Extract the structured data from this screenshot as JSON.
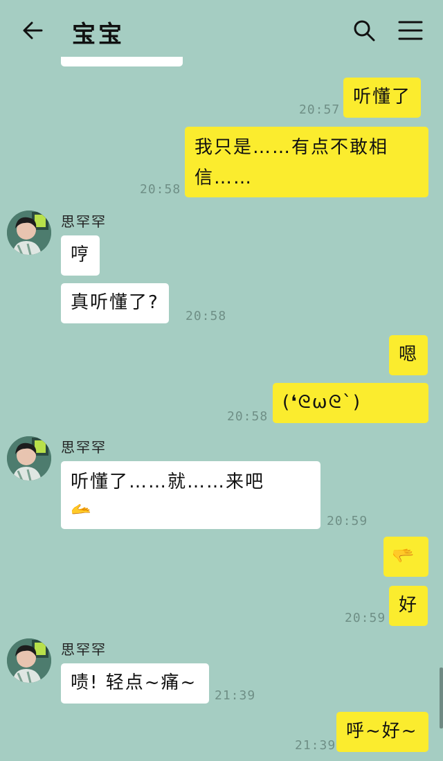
{
  "header": {
    "title": "宝宝",
    "back_icon": "arrow-left-icon",
    "search_icon": "search-icon",
    "menu_icon": "menu-icon"
  },
  "contact": {
    "name": "思罕罕"
  },
  "messages": [
    {
      "from": "me",
      "text": "听懂了",
      "time": "20:57"
    },
    {
      "from": "me",
      "text": "我只是……有点不敢相信……",
      "time": "20:58"
    },
    {
      "from": "them",
      "text": "哼",
      "time": ""
    },
    {
      "from": "them",
      "text": "真听懂了?",
      "time": "20:58"
    },
    {
      "from": "me",
      "text": "嗯",
      "time": ""
    },
    {
      "from": "me",
      "text": "(❛ᘓωᘓ`)",
      "time": "20:58"
    },
    {
      "from": "them",
      "text": "听懂了……就……来吧",
      "emoji": "🫴",
      "time": "20:59"
    },
    {
      "from": "me",
      "emoji": "🫳",
      "time": ""
    },
    {
      "from": "me",
      "text": "好",
      "time": "20:59"
    },
    {
      "from": "them",
      "text": "啧! 轻点~痛~",
      "time": "21:39"
    },
    {
      "from": "me",
      "text": "呼~好~",
      "time": "21:39"
    }
  ],
  "colors": {
    "background": "#a5cdc2",
    "my_bubble": "#fbec2e",
    "their_bubble": "#ffffff"
  }
}
